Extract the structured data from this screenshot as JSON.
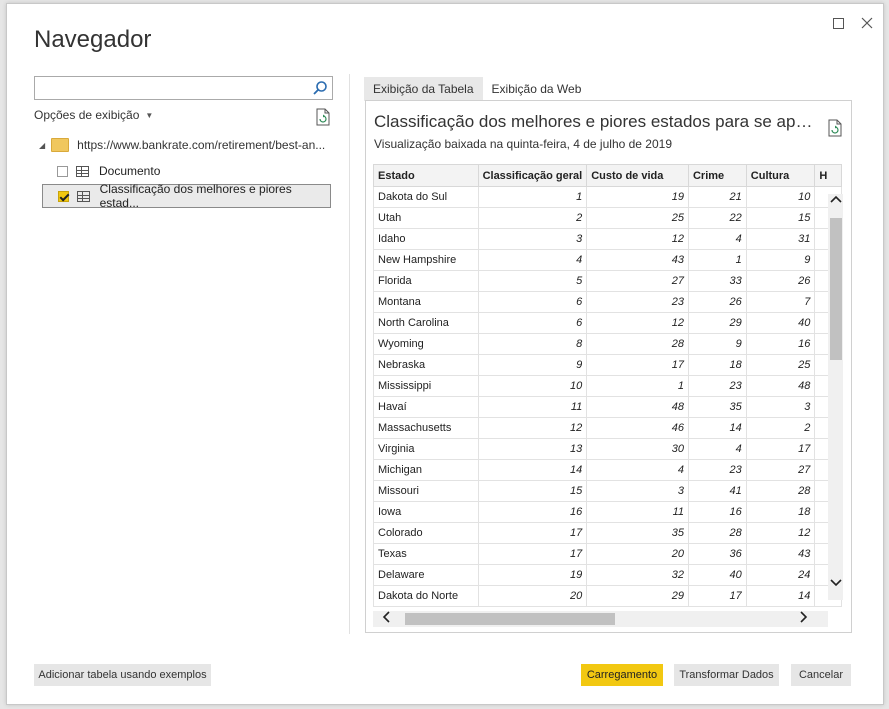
{
  "dialog": {
    "title": "Navegador"
  },
  "search": {
    "value": "",
    "placeholder": ""
  },
  "left": {
    "view_options": "Opções de exibição",
    "source_url": "https://www.bankrate.com/retirement/best-an...",
    "items": [
      {
        "label": "Documento",
        "checked": false
      },
      {
        "label": "Classificação dos melhores e piores estad...",
        "checked": true
      }
    ]
  },
  "tabs": [
    "Exibição da Tabela",
    "Exibição da Web"
  ],
  "preview": {
    "title": "Classificação dos melhores e piores estados para se apos...",
    "subtitle": "Visualização baixada na quinta-feira, 4 de julho de 2019",
    "columns": [
      "Estado",
      "Classificação geral",
      "Custo de vida",
      "Crime",
      "Cultura",
      "H"
    ],
    "rows": [
      [
        "Dakota do Sul",
        "1",
        "19",
        "21",
        "10"
      ],
      [
        "Utah",
        "2",
        "25",
        "22",
        "15"
      ],
      [
        "Idaho",
        "3",
        "12",
        "4",
        "31"
      ],
      [
        "New Hampshire",
        "4",
        "43",
        "1",
        "9"
      ],
      [
        "Florida",
        "5",
        "27",
        "33",
        "26"
      ],
      [
        "Montana",
        "6",
        "23",
        "26",
        "7"
      ],
      [
        "North Carolina",
        "6",
        "12",
        "29",
        "40"
      ],
      [
        "Wyoming",
        "8",
        "28",
        "9",
        "16"
      ],
      [
        "Nebraska",
        "9",
        "17",
        "18",
        "25"
      ],
      [
        "Mississippi",
        "10",
        "1",
        "23",
        "48"
      ],
      [
        "Havaí",
        "11",
        "48",
        "35",
        "3"
      ],
      [
        "Massachusetts",
        "12",
        "46",
        "14",
        "2"
      ],
      [
        "Virginia",
        "13",
        "30",
        "4",
        "17"
      ],
      [
        "Michigan",
        "14",
        "4",
        "23",
        "27"
      ],
      [
        "Missouri",
        "15",
        "3",
        "41",
        "28"
      ],
      [
        "Iowa",
        "16",
        "11",
        "16",
        "18"
      ],
      [
        "Colorado",
        "17",
        "35",
        "28",
        "12"
      ],
      [
        "Texas",
        "17",
        "20",
        "36",
        "43"
      ],
      [
        "Delaware",
        "19",
        "32",
        "40",
        "24"
      ],
      [
        "Dakota do Norte",
        "20",
        "29",
        "17",
        "14"
      ]
    ]
  },
  "footer": {
    "add_table": "Adicionar tabela usando exemplos",
    "load": "Carregamento",
    "transform": "Transformar Dados",
    "cancel": "Cancelar"
  },
  "colors": {
    "accent": "#f2c811",
    "folder": "#f0c75e"
  }
}
